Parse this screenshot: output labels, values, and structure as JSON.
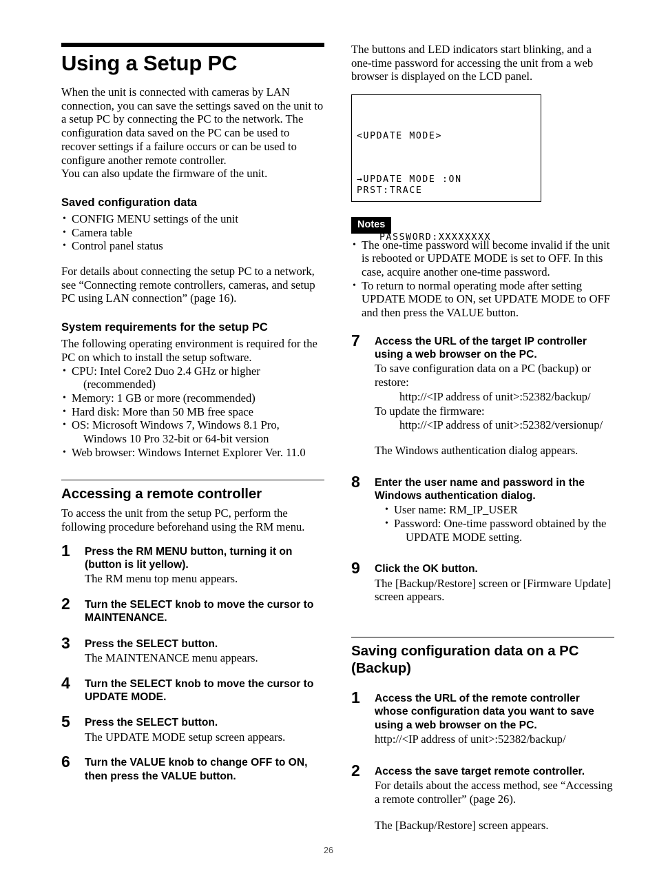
{
  "page": {
    "number": "26"
  },
  "left": {
    "title": "Using a Setup PC",
    "intro": "When the unit is connected with cameras by LAN connection, you can save the settings saved on the unit to a setup PC by connecting the PC to the network. The configuration data saved on the PC can be used to recover settings if a failure occurs or can be used to configure another remote controller.",
    "intro2": "You can also update the firmware of the unit.",
    "saved_config": {
      "heading": "Saved configuration data",
      "items": [
        "CONFIG MENU settings of the unit",
        "Camera table",
        "Control panel status"
      ],
      "note": "For details about connecting the setup PC to a network, see “Connecting remote controllers, cameras, and setup PC using LAN connection” (page 16)."
    },
    "system_req": {
      "heading": "System requirements for the setup PC",
      "intro": "The following operating environment is required for the PC on which to install the setup software.",
      "items": [
        {
          "text": "CPU: Intel Core2 Duo 2.4 GHz or higher",
          "cont": "(recommended)"
        },
        {
          "text": "Memory: 1 GB or more (recommended)",
          "cont": ""
        },
        {
          "text": "Hard disk: More than 50 MB free space",
          "cont": ""
        },
        {
          "text": "OS: Microsoft Windows 7, Windows 8.1 Pro,",
          "cont": "Windows 10 Pro 32-bit or 64-bit version"
        },
        {
          "text": "Web browser: Windows Internet Explorer Ver. 11.0",
          "cont": ""
        }
      ]
    },
    "accessing": {
      "heading": "Accessing a remote controller",
      "intro": "To access the unit from the setup PC, perform the following procedure beforehand using the RM menu."
    },
    "steps": [
      {
        "num": "1",
        "lead": "Press the RM MENU button, turning it on (button is lit yellow).",
        "detail": "The RM menu top menu appears."
      },
      {
        "num": "2",
        "lead": "Turn the SELECT knob to move the cursor to MAINTENANCE.",
        "detail": ""
      },
      {
        "num": "3",
        "lead": "Press the SELECT button.",
        "detail": "The MAINTENANCE menu appears."
      },
      {
        "num": "4",
        "lead": "Turn the SELECT knob to move the cursor to UPDATE MODE.",
        "detail": ""
      },
      {
        "num": "5",
        "lead": "Press the SELECT button.",
        "detail": "The UPDATE MODE setup screen appears."
      },
      {
        "num": "6",
        "lead": "Turn the VALUE knob to change OFF to ON, then press the VALUE button.",
        "detail": ""
      }
    ]
  },
  "right": {
    "intro": "The buttons and LED indicators start blinking, and a one-time password for accessing the unit from a web browser is displayed on the LCD panel.",
    "lcd": {
      "line1": "<UPDATE MODE>",
      "line2": "→UPDATE MODE :ON",
      "line3": "PASSWORD:XXXXXXXX",
      "line4": "PRST:TRACE"
    },
    "notes": {
      "badge": "Notes",
      "items": [
        "The one-time password will become invalid if the unit is rebooted or UPDATE MODE is set to OFF. In this case, acquire another one-time password.",
        "To return to normal operating mode after setting UPDATE MODE to ON, set UPDATE MODE to OFF and then press the VALUE button."
      ]
    },
    "step7": {
      "num": "7",
      "lead": "Access the URL of the target IP controller using a web browser on the PC.",
      "d1": "To save configuration data on a PC (backup) or restore:",
      "url1": "http://<IP address of unit>:52382/backup/",
      "d2": "To update the firmware:",
      "url2": "http://<IP address of unit>:52382/versionup/",
      "d3": "The Windows authentication dialog appears."
    },
    "step8": {
      "num": "8",
      "lead": "Enter the user name and password in the Windows authentication dialog.",
      "items": [
        {
          "text": "User name: RM_IP_USER",
          "cont": ""
        },
        {
          "text": "Password: One-time password obtained by the",
          "cont": "UPDATE MODE setting."
        }
      ]
    },
    "step9": {
      "num": "9",
      "lead": "Click the OK button.",
      "detail": "The [Backup/Restore] screen or [Firmware Update] screen appears."
    },
    "saving": {
      "heading": "Saving configuration data on a PC (Backup)"
    },
    "save_steps": [
      {
        "num": "1",
        "lead": "Access the URL of the remote controller whose configuration data you want to save using a web browser on the PC.",
        "detail": "http://<IP address of unit>:52382/backup/"
      },
      {
        "num": "2",
        "lead": "Access the save target remote controller.",
        "detail": "For details about the access method, see “Accessing a remote controller” (page 26)."
      }
    ],
    "closing": "The [Backup/Restore] screen appears."
  }
}
